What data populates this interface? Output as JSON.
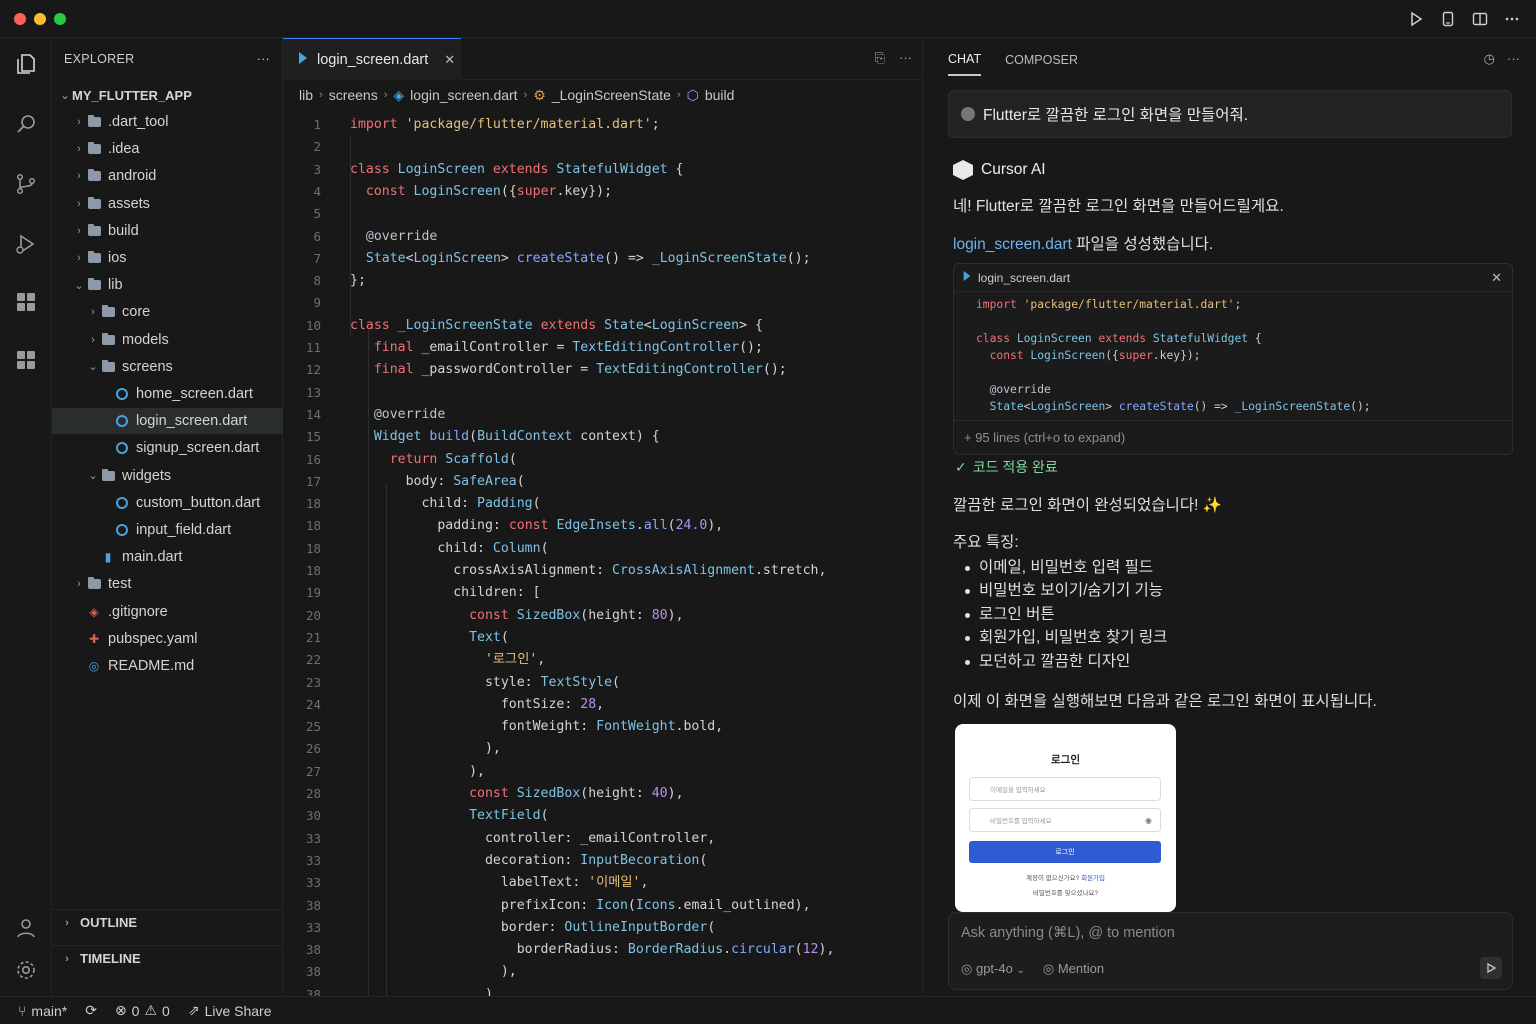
{
  "titlebar": {
    "actions": [
      "play-icon",
      "device-icon",
      "split-icon",
      "more-icon"
    ]
  },
  "activity_bar": [
    "files-icon",
    "search-icon",
    "source-control-icon",
    "run-debug-icon",
    "extensions-icon",
    "remote-icon",
    "account-icon",
    "settings-icon"
  ],
  "sidebar": {
    "title": "EXPLORER",
    "more": "···",
    "root": "MY_FLUTTER_APP",
    "items": [
      {
        "label": ".dart_tool",
        "kind": "folder",
        "depth": 1
      },
      {
        "label": ".idea",
        "kind": "folder",
        "depth": 1
      },
      {
        "label": "android",
        "kind": "folder",
        "depth": 1
      },
      {
        "label": "assets",
        "kind": "folder",
        "depth": 1
      },
      {
        "label": "build",
        "kind": "folder",
        "depth": 1
      },
      {
        "label": "ios",
        "kind": "folder",
        "depth": 1
      },
      {
        "label": "lib",
        "kind": "folder-open",
        "depth": 1
      },
      {
        "label": "core",
        "kind": "folder",
        "depth": 2
      },
      {
        "label": "models",
        "kind": "folder",
        "depth": 2
      },
      {
        "label": "screens",
        "kind": "folder-open",
        "depth": 2
      },
      {
        "label": "home_screen.dart",
        "kind": "dart",
        "depth": 3
      },
      {
        "label": "login_screen.dart",
        "kind": "dart",
        "depth": 3,
        "active": true
      },
      {
        "label": "signup_screen.dart",
        "kind": "dart",
        "depth": 3
      },
      {
        "label": "widgets",
        "kind": "folder-open",
        "depth": 2
      },
      {
        "label": "custom_button.dart",
        "kind": "dart",
        "depth": 3
      },
      {
        "label": "input_field.dart",
        "kind": "dart",
        "depth": 3
      },
      {
        "label": "main.dart",
        "kind": "file",
        "depth": 2
      },
      {
        "label": "test",
        "kind": "folder",
        "depth": 1
      },
      {
        "label": ".gitignore",
        "kind": "git",
        "depth": 1
      },
      {
        "label": "pubspec.yaml",
        "kind": "yaml",
        "depth": 1
      },
      {
        "label": "README.md",
        "kind": "md",
        "depth": 1
      }
    ],
    "outline": "OUTLINE",
    "timeline": "TIMELINE"
  },
  "editor": {
    "tab": "login_screen.dart",
    "breadcrumb": [
      "lib",
      "screens",
      "login_screen.dart",
      "_LoginScreenState",
      "build"
    ],
    "lines": [
      {
        "n": "1",
        "c": [
          [
            "kw",
            "import "
          ],
          [
            "str",
            "'package/flutter/material.dart'"
          ],
          [
            "",
            ";"
          ]
        ]
      },
      {
        "n": "2",
        "c": []
      },
      {
        "n": "3",
        "c": [
          [
            "kw",
            "class "
          ],
          [
            "ty",
            "LoginScreen "
          ],
          [
            "kw",
            "extends "
          ],
          [
            "ty",
            "StatefulWidget"
          ],
          [
            "",
            " {"
          ]
        ]
      },
      {
        "n": "4",
        "c": [
          [
            "",
            "  "
          ],
          [
            "kw",
            "const "
          ],
          [
            "ty",
            "LoginScreen"
          ],
          [
            "",
            "({"
          ],
          [
            "kw",
            "super"
          ],
          [
            "",
            ".key});"
          ]
        ]
      },
      {
        "n": "5",
        "c": []
      },
      {
        "n": "6",
        "c": [
          [
            "",
            "  "
          ],
          [
            "at",
            "@override"
          ]
        ]
      },
      {
        "n": "7",
        "c": [
          [
            "",
            "  "
          ],
          [
            "ty",
            "State"
          ],
          [
            "",
            "<"
          ],
          [
            "ty",
            "LoginScreen"
          ],
          [
            "",
            "> "
          ],
          [
            "fn",
            "createState"
          ],
          [
            "",
            "() => "
          ],
          [
            "ty",
            "_LoginScreenState"
          ],
          [
            "",
            "();"
          ]
        ]
      },
      {
        "n": "8",
        "c": [
          [
            "",
            "};"
          ]
        ]
      },
      {
        "n": "9",
        "c": []
      },
      {
        "n": "10",
        "c": [
          [
            "kw",
            "class "
          ],
          [
            "ty",
            "_LoginScreenState "
          ],
          [
            "kw",
            "extends "
          ],
          [
            "ty",
            "State"
          ],
          [
            "",
            "<"
          ],
          [
            "ty",
            "LoginScreen"
          ],
          [
            "",
            "> {"
          ]
        ]
      },
      {
        "n": "11",
        "c": [
          [
            "",
            "   "
          ],
          [
            "kw",
            "final "
          ],
          [
            "",
            "_emailController = "
          ],
          [
            "ty",
            "TextEditingController"
          ],
          [
            "",
            "();"
          ]
        ]
      },
      {
        "n": "12",
        "c": [
          [
            "",
            "   "
          ],
          [
            "kw",
            "final "
          ],
          [
            "",
            "_passwordController = "
          ],
          [
            "ty",
            "TextEditingController"
          ],
          [
            "",
            "();"
          ]
        ]
      },
      {
        "n": "13",
        "c": []
      },
      {
        "n": "14",
        "c": [
          [
            "",
            "   "
          ],
          [
            "at",
            "@override"
          ]
        ]
      },
      {
        "n": "15",
        "c": [
          [
            "",
            "   "
          ],
          [
            "ty",
            "Widget "
          ],
          [
            "fn",
            "build"
          ],
          [
            "",
            "("
          ],
          [
            "ty",
            "BuildContext "
          ],
          [
            "",
            "context) {"
          ]
        ]
      },
      {
        "n": "16",
        "c": [
          [
            "",
            "     "
          ],
          [
            "kw",
            "return "
          ],
          [
            "ty",
            "Scaffold"
          ],
          [
            "",
            "("
          ]
        ]
      },
      {
        "n": "17",
        "c": [
          [
            "",
            "       "
          ],
          [
            "",
            "body: "
          ],
          [
            "ty",
            "SafeArea"
          ],
          [
            "",
            "("
          ]
        ]
      },
      {
        "n": "18",
        "c": [
          [
            "",
            "         "
          ],
          [
            "",
            "child: "
          ],
          [
            "ty",
            "Padding"
          ],
          [
            "",
            "("
          ]
        ]
      },
      {
        "n": "18",
        "c": [
          [
            "",
            "           "
          ],
          [
            "",
            "padding: "
          ],
          [
            "kw",
            "const "
          ],
          [
            "ty",
            "EdgeInsets"
          ],
          [
            "",
            "."
          ],
          [
            "fn",
            "all"
          ],
          [
            "",
            "("
          ],
          [
            "num",
            "24.0"
          ],
          [
            "",
            "),"
          ]
        ]
      },
      {
        "n": "18",
        "c": [
          [
            "",
            "           "
          ],
          [
            "",
            "child: "
          ],
          [
            "ty",
            "Column"
          ],
          [
            "",
            "("
          ]
        ]
      },
      {
        "n": "18",
        "c": [
          [
            "",
            "             "
          ],
          [
            "",
            "crossAxisAlignment: "
          ],
          [
            "ty",
            "CrossAxisAlignment"
          ],
          [
            "",
            ".stretch,"
          ]
        ]
      },
      {
        "n": "19",
        "c": [
          [
            "",
            "             "
          ],
          [
            "",
            "children: ["
          ]
        ]
      },
      {
        "n": "20",
        "c": [
          [
            "",
            "               "
          ],
          [
            "kw",
            "const "
          ],
          [
            "ty",
            "SizedBox"
          ],
          [
            "",
            "(height: "
          ],
          [
            "num",
            "80"
          ],
          [
            "",
            "),"
          ]
        ]
      },
      {
        "n": "21",
        "c": [
          [
            "",
            "               "
          ],
          [
            "ty",
            "Text"
          ],
          [
            "",
            "("
          ]
        ]
      },
      {
        "n": "22",
        "c": [
          [
            "",
            "                 "
          ],
          [
            "str",
            "'로그인'"
          ],
          [
            "",
            ","
          ]
        ]
      },
      {
        "n": "23",
        "c": [
          [
            "",
            "                 "
          ],
          [
            "",
            "style: "
          ],
          [
            "ty",
            "TextStyle"
          ],
          [
            "",
            "("
          ]
        ]
      },
      {
        "n": "24",
        "c": [
          [
            "",
            "                   "
          ],
          [
            "",
            "fontSize: "
          ],
          [
            "num",
            "28"
          ],
          [
            "",
            ","
          ]
        ]
      },
      {
        "n": "25",
        "c": [
          [
            "",
            "                   "
          ],
          [
            "",
            "fontWeight: "
          ],
          [
            "ty",
            "FontWeight"
          ],
          [
            "",
            ".bold,"
          ]
        ]
      },
      {
        "n": "26",
        "c": [
          [
            "",
            "                 "
          ],
          [
            "",
            "),"
          ]
        ]
      },
      {
        "n": "27",
        "c": [
          [
            "",
            "               "
          ],
          [
            "",
            "),"
          ]
        ]
      },
      {
        "n": "28",
        "c": [
          [
            "",
            "               "
          ],
          [
            "kw",
            "const "
          ],
          [
            "ty",
            "SizedBox"
          ],
          [
            "",
            "(height: "
          ],
          [
            "num",
            "40"
          ],
          [
            "",
            "),"
          ]
        ]
      },
      {
        "n": "30",
        "c": [
          [
            "",
            "               "
          ],
          [
            "ty",
            "TextField"
          ],
          [
            "",
            "("
          ]
        ]
      },
      {
        "n": "33",
        "c": [
          [
            "",
            "                 "
          ],
          [
            "",
            "controller: _emailController,"
          ]
        ]
      },
      {
        "n": "33",
        "c": [
          [
            "",
            "                 "
          ],
          [
            "",
            "decoration: "
          ],
          [
            "ty",
            "InputBecoration"
          ],
          [
            "",
            "("
          ]
        ]
      },
      {
        "n": "33",
        "c": [
          [
            "",
            "                   "
          ],
          [
            "",
            "labelText: "
          ],
          [
            "str",
            "'이메일'"
          ],
          [
            "",
            ","
          ]
        ]
      },
      {
        "n": "38",
        "c": [
          [
            "",
            "                   "
          ],
          [
            "",
            "prefixIcon: "
          ],
          [
            "ty",
            "Icon"
          ],
          [
            "",
            "("
          ],
          [
            "ty",
            "Icons"
          ],
          [
            "",
            ".email_outlined),"
          ]
        ]
      },
      {
        "n": "33",
        "c": [
          [
            "",
            "                   "
          ],
          [
            "",
            "border: "
          ],
          [
            "ty",
            "OutlineInputBorder"
          ],
          [
            "",
            "("
          ]
        ]
      },
      {
        "n": "38",
        "c": [
          [
            "",
            "                     "
          ],
          [
            "",
            "borderRadius: "
          ],
          [
            "ty",
            "BorderRadius"
          ],
          [
            "",
            "."
          ],
          [
            "fn",
            "circular"
          ],
          [
            "",
            "("
          ],
          [
            "num",
            "12"
          ],
          [
            "",
            "),"
          ]
        ]
      },
      {
        "n": "38",
        "c": [
          [
            "",
            "                   "
          ],
          [
            "",
            "),"
          ]
        ]
      },
      {
        "n": "38",
        "c": [
          [
            "",
            "                 "
          ],
          [
            "",
            "),"
          ]
        ]
      },
      {
        "n": "38",
        "c": [
          [
            "",
            "               "
          ],
          [
            "",
            "),"
          ]
        ]
      }
    ]
  },
  "chat": {
    "tabs": [
      "CHAT",
      "COMPOSER"
    ],
    "user_message": "Flutter로 깔끔한 로그인 화면을 만들어줘.",
    "assistant_name": "Cursor AI",
    "reply_intro": "네! Flutter로 깔끔한 로그인 화면을 만들어드릴게요.",
    "created_file_link": "login_screen.dart",
    "created_file_suffix": " 파일을 성성했습니다.",
    "card": {
      "filename": "login_screen.dart",
      "lines": [
        [
          [
            "kw",
            "import "
          ],
          [
            "str",
            "'package/flutter/material.dart'"
          ],
          [
            "",
            ";"
          ]
        ],
        [],
        [
          [
            "kw",
            "class "
          ],
          [
            "ty",
            "LoginScreen "
          ],
          [
            "kw",
            "extends "
          ],
          [
            "ty",
            "StatefulWidget"
          ],
          [
            "",
            " {"
          ]
        ],
        [
          [
            "",
            "  "
          ],
          [
            "kw",
            "const "
          ],
          [
            "ty",
            "LoginScreen"
          ],
          [
            "",
            "({"
          ],
          [
            "kw",
            "super"
          ],
          [
            "",
            ".key});"
          ]
        ],
        [],
        [
          [
            "",
            "  "
          ],
          [
            "at",
            "@override"
          ]
        ],
        [
          [
            "",
            "  "
          ],
          [
            "ty",
            "State"
          ],
          [
            "",
            "<"
          ],
          [
            "ty",
            "LoginScreen"
          ],
          [
            "",
            "> "
          ],
          [
            "fn",
            "createState"
          ],
          [
            "",
            "() => "
          ],
          [
            "ty",
            "_LoginScreenState"
          ],
          [
            "",
            "();"
          ]
        ]
      ],
      "expand_hint": "+ 95 lines (ctrl+o to expand)"
    },
    "applied_label": "코드 적용 완료",
    "done_text": "깔끔한 로그인 화면이 완성되었습니다! ✨",
    "features_title": "주요 특징:",
    "features": [
      "이메일, 비밀번호 입력 필드",
      "비밀번호 보이기/숨기기 기능",
      "로그인 버튼",
      "회원가입, 비밀번호 찾기 링크",
      "모던하고 깔끔한 디자인"
    ],
    "preview_intro": "이제 이 화면을 실행해보면 다음과 같은 로그인 화면이 표시됩니다.",
    "preview": {
      "title": "로그인",
      "email_placeholder": "이메일을 입력하세요",
      "password_placeholder": "비밀번호를 입력하세요",
      "button": "로그인",
      "signup_prompt": "계정이 없으신가요?",
      "signup_link": "회원가입",
      "forgot": "비밀번호를 잊으셨나요?"
    },
    "input_placeholder": "Ask anything (⌘L), @ to mention",
    "model": "gpt-4o",
    "mention": "Mention"
  },
  "statusbar": {
    "branch": "main*",
    "errors": "0",
    "warnings": "0",
    "live_share": "Live Share"
  }
}
